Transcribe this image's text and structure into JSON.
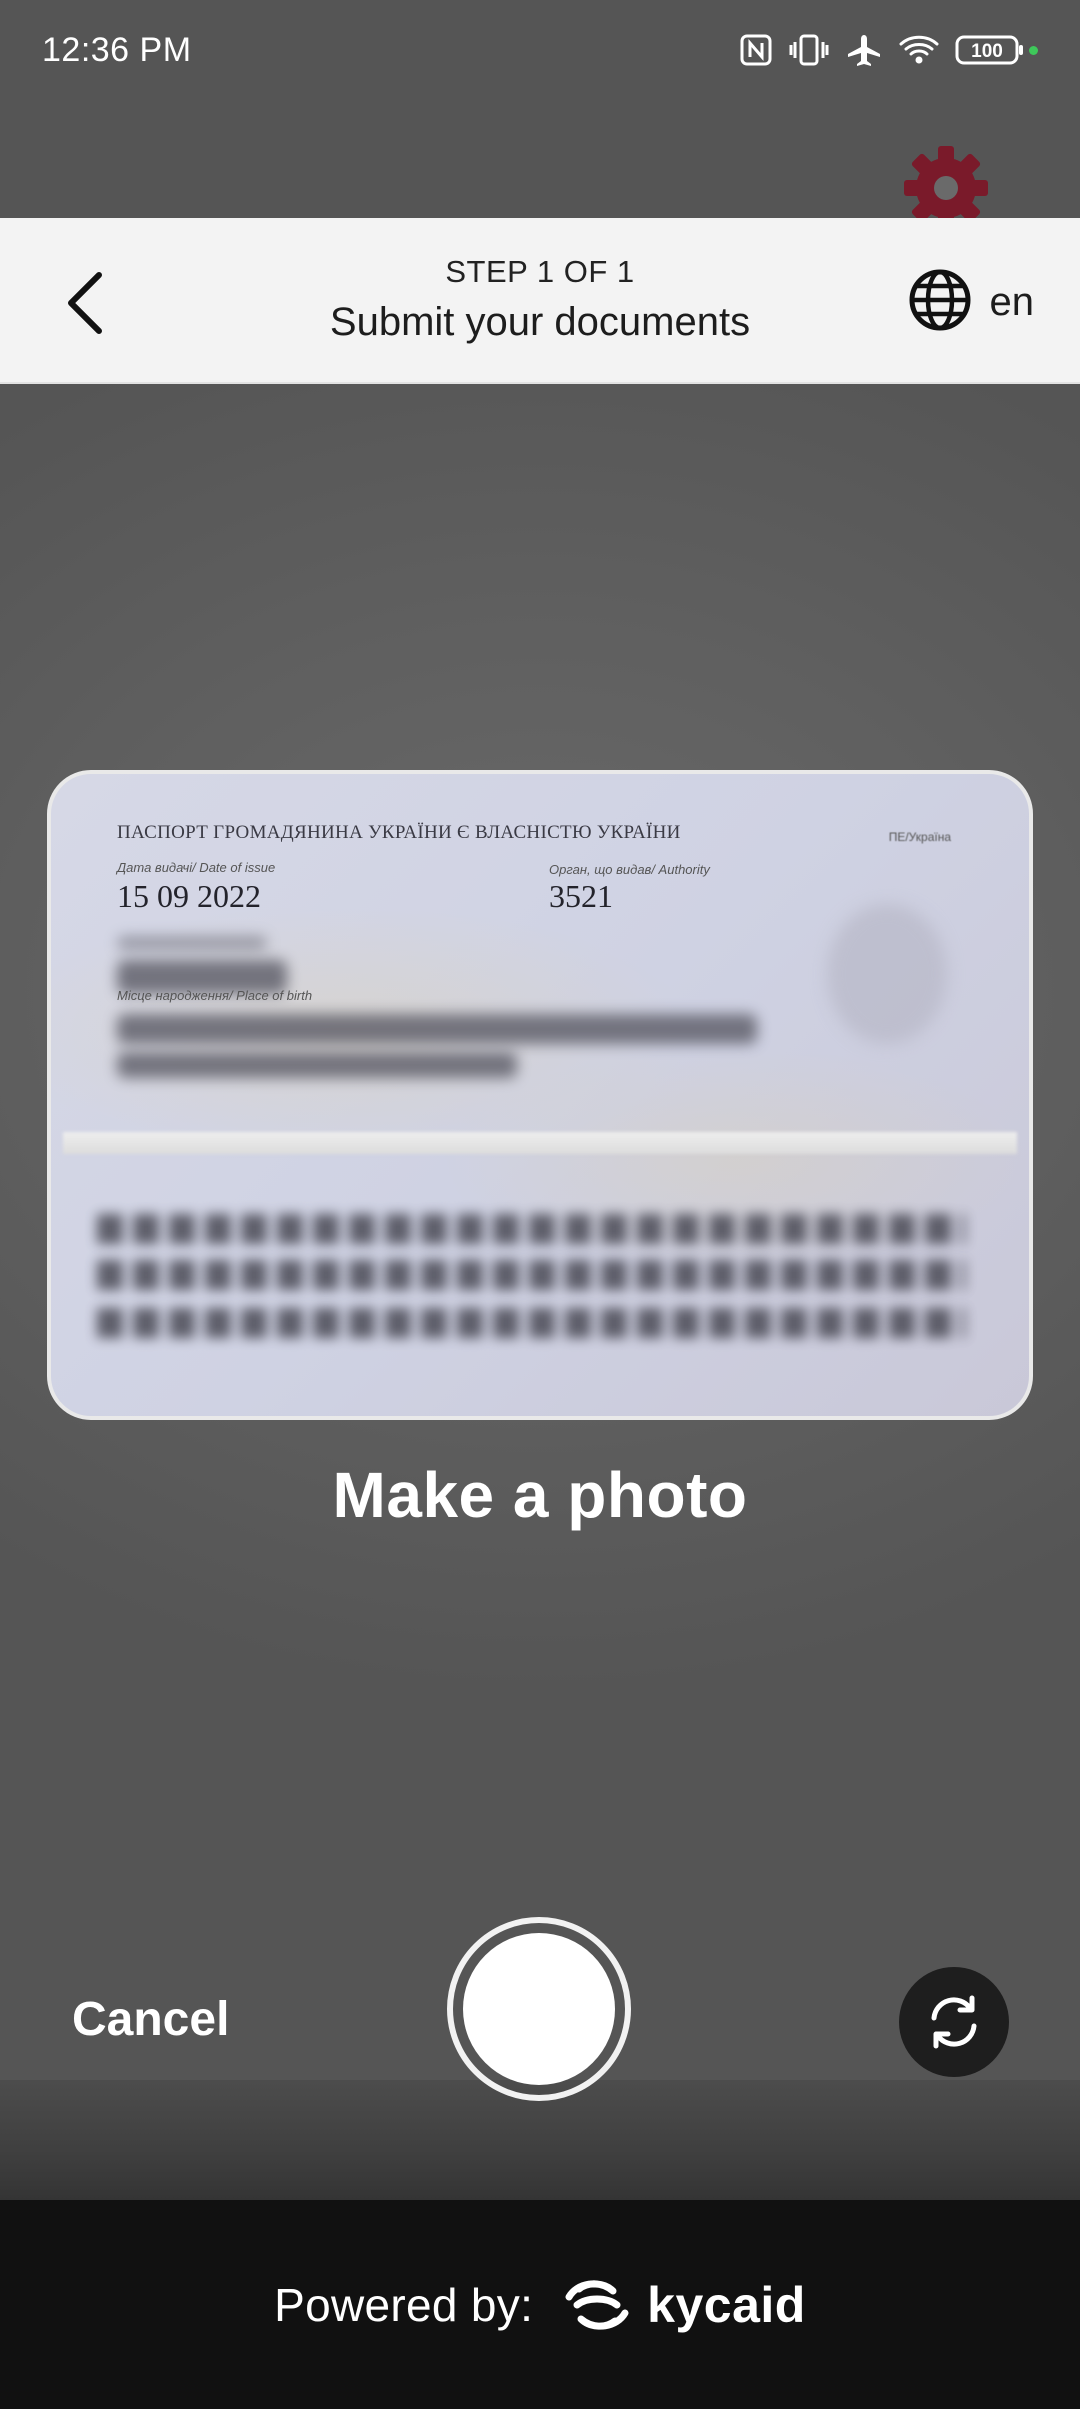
{
  "status_bar": {
    "time": "12:36 PM",
    "battery": "100",
    "icons": [
      "nfc-icon",
      "vibrate-icon",
      "airplane-icon",
      "wifi-icon",
      "battery-icon"
    ]
  },
  "header": {
    "step": "STEP 1 OF 1",
    "title": "Submit your documents",
    "language": "en"
  },
  "document_preview": {
    "heading": "ПАСПОРТ ГРОМАДЯНИНА УКРАЇНИ Є ВЛАСНІСТЮ УКРАЇНИ",
    "corner_text": "ПЕ/Україна",
    "date_label": "Дата видачі/ Date of issue",
    "date_value": "15 09 2022",
    "authority_label": "Орган, що видав/ Authority",
    "authority_value": "3521",
    "birth_label": "Місце народження/ Place of birth"
  },
  "camera": {
    "instruction": "Make a photo",
    "cancel_label": "Cancel"
  },
  "footer": {
    "powered_by": "Powered by:",
    "brand": "kycaid"
  },
  "colors": {
    "header_bg": "#f3f3f3",
    "footer_bg": "#111111",
    "accent_gear": "#7a1a2a"
  }
}
